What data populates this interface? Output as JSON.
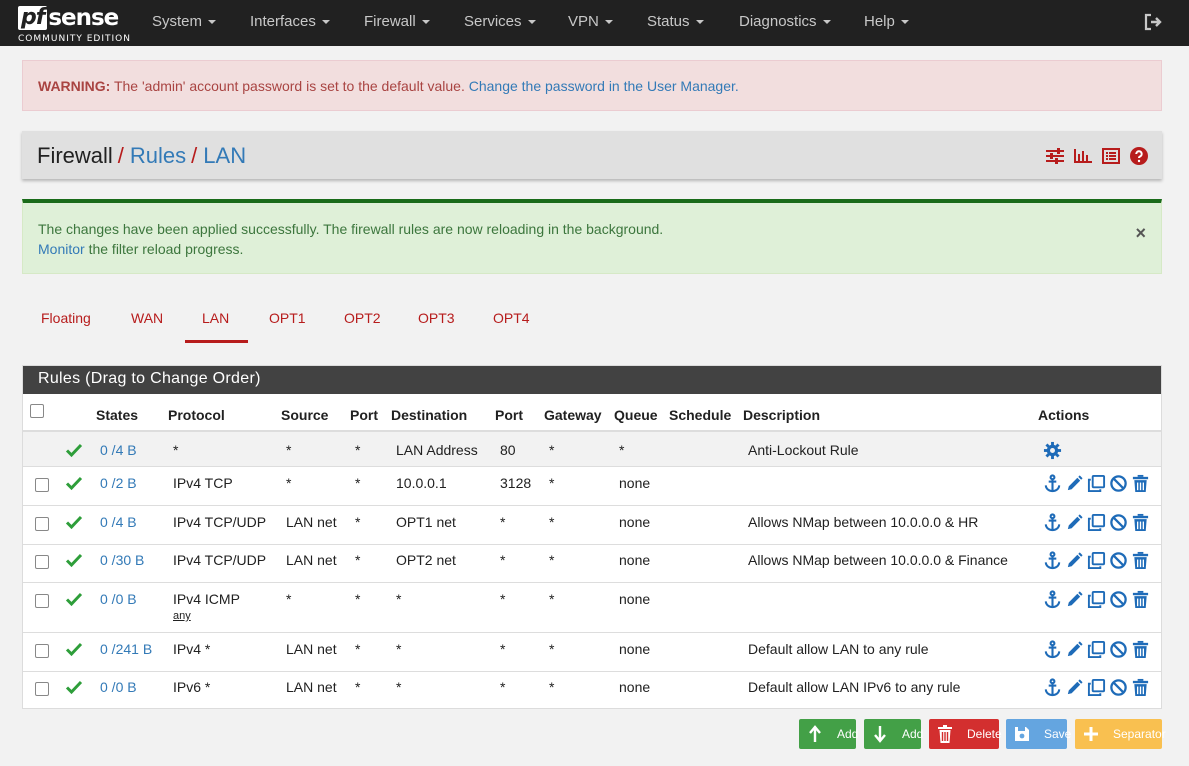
{
  "brand": {
    "logo_text_pf": "pf",
    "logo_text_sense": "sense",
    "logo_subtitle": "COMMUNITY EDITION"
  },
  "nav": [
    "System",
    "Interfaces",
    "Firewall",
    "Services",
    "VPN",
    "Status",
    "Diagnostics",
    "Help"
  ],
  "warning": {
    "label": "WARNING:",
    "text": "The 'admin' account password is set to the default value.",
    "link": "Change the password in the User Manager."
  },
  "breadcrumb": {
    "root": "Firewall",
    "sep": "/",
    "level2": "Rules",
    "level3": "LAN"
  },
  "success": {
    "line1": "The changes have been applied successfully. The firewall rules are now reloading in the background.",
    "link": "Monitor",
    "line2_rest": "the filter reload progress.",
    "close": "×"
  },
  "tabs": [
    "Floating",
    "WAN",
    "LAN",
    "OPT1",
    "OPT2",
    "OPT3",
    "OPT4"
  ],
  "active_tab": "LAN",
  "panel_title": "Rules (Drag to Change Order)",
  "columns": [
    "States",
    "Protocol",
    "Source",
    "Port",
    "Destination",
    "Port",
    "Gateway",
    "Queue",
    "Schedule",
    "Description",
    "Actions"
  ],
  "rules": [
    {
      "states": "0 /4 B",
      "protocol": "*",
      "source": "*",
      "sport": "*",
      "dest": "LAN Address",
      "dport": "80",
      "gateway": "*",
      "queue": "*",
      "schedule": "",
      "description": "Anti-Lockout Rule",
      "sub": ""
    },
    {
      "states": "0 /2 B",
      "protocol": "IPv4 TCP",
      "source": "*",
      "sport": "*",
      "dest": "10.0.0.1",
      "dport": "3128",
      "gateway": "*",
      "queue": "none",
      "schedule": "",
      "description": "",
      "sub": ""
    },
    {
      "states": "0 /4 B",
      "protocol": "IPv4 TCP/UDP",
      "source": "LAN net",
      "sport": "*",
      "dest": "OPT1 net",
      "dport": "*",
      "gateway": "*",
      "queue": "none",
      "schedule": "",
      "description": "Allows NMap between 10.0.0.0 & HR",
      "sub": ""
    },
    {
      "states": "0 /30 B",
      "protocol": "IPv4 TCP/UDP",
      "source": "LAN net",
      "sport": "*",
      "dest": "OPT2 net",
      "dport": "*",
      "gateway": "*",
      "queue": "none",
      "schedule": "",
      "description": "Allows NMap between 10.0.0.0 & Finance",
      "sub": ""
    },
    {
      "states": "0 /0 B",
      "protocol": "IPv4 ICMP",
      "source": "*",
      "sport": "*",
      "dest": "*",
      "dport": "*",
      "gateway": "*",
      "queue": "none",
      "schedule": "",
      "description": "",
      "sub": "any"
    },
    {
      "states": "0 /241 B",
      "protocol": "IPv4 *",
      "source": "LAN net",
      "sport": "*",
      "dest": "*",
      "dport": "*",
      "gateway": "*",
      "queue": "none",
      "schedule": "",
      "description": "Default allow LAN to any rule",
      "sub": ""
    },
    {
      "states": "0 /0 B",
      "protocol": "IPv6 *",
      "source": "LAN net",
      "sport": "*",
      "dest": "*",
      "dport": "*",
      "gateway": "*",
      "queue": "none",
      "schedule": "",
      "description": "Default allow LAN IPv6 to any rule",
      "sub": ""
    }
  ],
  "buttons": {
    "add_top": "Add",
    "add_bottom": "Add",
    "delete": "Delete",
    "save": "Save",
    "separator": "Separator"
  },
  "colors": {
    "accent_red": "#b71c1c",
    "link_blue": "#337ab7",
    "check_green": "#2e9e3a",
    "action_blue": "#1e6bb8"
  }
}
